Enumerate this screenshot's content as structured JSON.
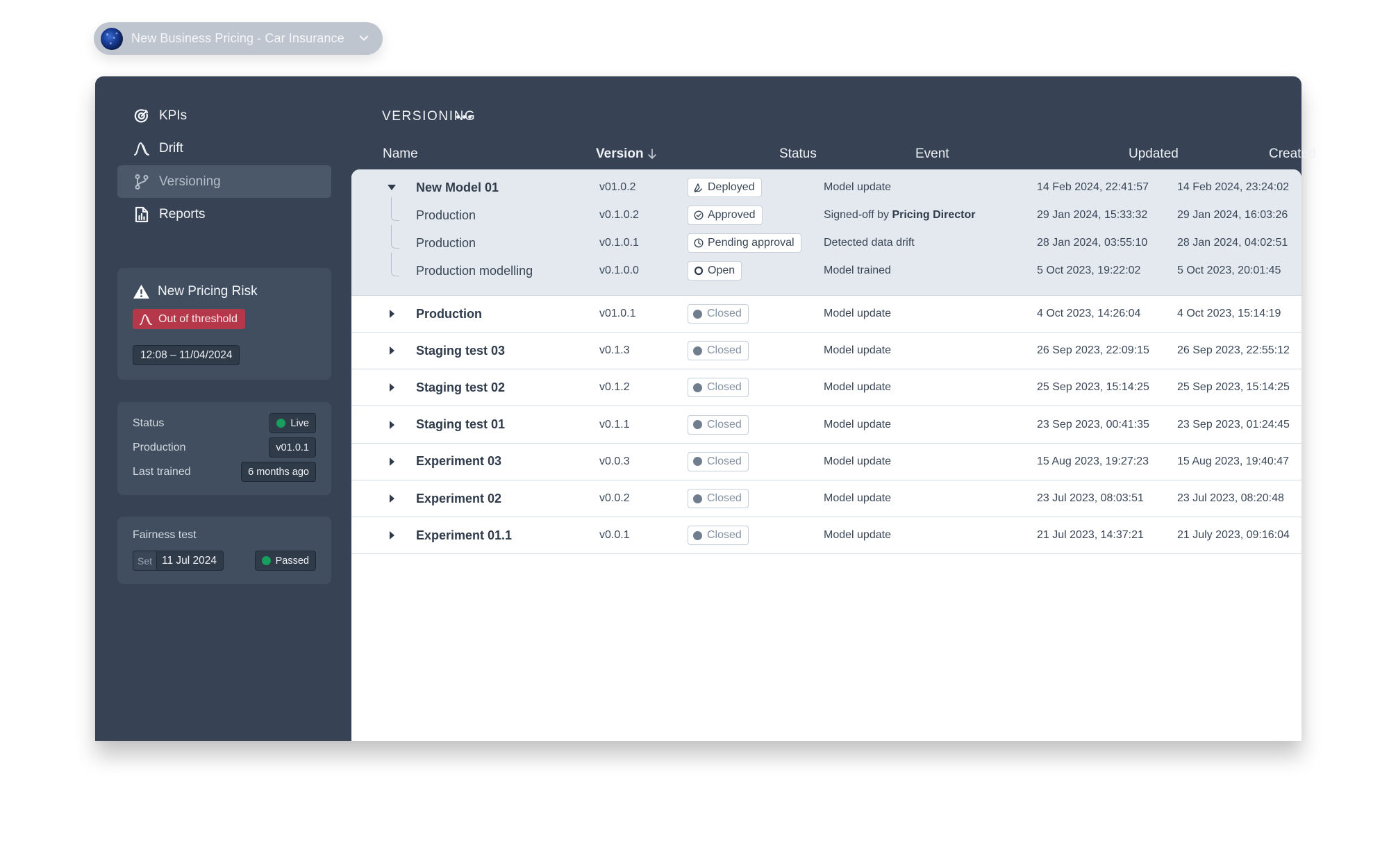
{
  "project_selector": {
    "name": "New Business Pricing - Car Insurance",
    "avatar_icon": "galaxy-avatar",
    "chevron_icon": "chevron-down-icon"
  },
  "sidebar": {
    "nav": [
      {
        "label": "KPIs",
        "icon": "target-icon",
        "active": false
      },
      {
        "label": "Drift",
        "icon": "drift-curve-icon",
        "active": false
      },
      {
        "label": "Versioning",
        "icon": "git-branch-icon",
        "active": true
      },
      {
        "label": "Reports",
        "icon": "report-icon",
        "active": false
      }
    ],
    "risk_card": {
      "title": "New Pricing Risk",
      "title_icon": "warning-icon",
      "badge": "Out of threshold",
      "badge_icon": "drift-curve-icon",
      "badge_color": "#b5374a",
      "time_range": "12:08 – 11/04/2024"
    },
    "status_card": {
      "rows": [
        {
          "label": "Status",
          "value": "Live",
          "indicator_color": "#17a05d"
        },
        {
          "label": "Production",
          "value": "v01.0.1"
        },
        {
          "label": "Last trained",
          "value": "6 months ago"
        }
      ]
    },
    "fairness_card": {
      "title": "Fairness test",
      "set_label": "Set",
      "set_date": "11 Jul 2024",
      "result": "Passed",
      "result_color": "#17a05d"
    }
  },
  "main": {
    "section_title": "VERSIONING",
    "more_icon": "more-horizontal-icon",
    "columns": {
      "name": "Name",
      "version": "Version",
      "status": "Status",
      "event": "Event",
      "updated": "Updated",
      "created": "Created"
    },
    "sort": {
      "column": "version",
      "direction": "descending",
      "icon": "arrow-down-icon"
    },
    "expanded_group": {
      "parent": {
        "name": "New Model 01",
        "version": "v01.0.2",
        "status": "Deployed",
        "status_icon": "deploy-icon",
        "event": "Model update",
        "updated": "14 Feb 2024, 22:41:57",
        "created": "14 Feb 2024, 23:24:02"
      },
      "children": [
        {
          "name": "Production",
          "version": "v0.1.0.2",
          "status": "Approved",
          "status_icon": "check-circle-icon",
          "event_prefix": "Signed-off by ",
          "event_emphasis": "Pricing Director",
          "updated": "29 Jan 2024, 15:33:32",
          "created": "29 Jan 2024, 16:03:26"
        },
        {
          "name": "Production",
          "version": "v0.1.0.1",
          "status": "Pending approval",
          "status_icon": "clock-icon",
          "event_prefix": "Detected data drift",
          "event_emphasis": "",
          "updated": "28 Jan 2024, 03:55:10",
          "created": "28 Jan 2024, 04:02:51"
        },
        {
          "name": "Production modelling",
          "version": "v0.1.0.0",
          "status": "Open",
          "status_icon": "open-circle-icon",
          "event_prefix": "Model trained",
          "event_emphasis": "",
          "updated": "5 Oct 2023, 19:22:02",
          "created": "5 Oct 2023, 20:01:45"
        }
      ]
    },
    "rows": [
      {
        "name": "Production",
        "version": "v01.0.1",
        "status": "Closed",
        "event": "Model update",
        "updated": "4 Oct 2023, 14:26:04",
        "created": "4 Oct 2023, 15:14:19"
      },
      {
        "name": "Staging test 03",
        "version": "v0.1.3",
        "status": "Closed",
        "event": "Model update",
        "updated": "26 Sep 2023, 22:09:15",
        "created": "26 Sep 2023, 22:55:12"
      },
      {
        "name": "Staging test 02",
        "version": "v0.1.2",
        "status": "Closed",
        "event": "Model update",
        "updated": "25 Sep 2023, 15:14:25",
        "created": "25 Sep 2023, 15:14:25"
      },
      {
        "name": "Staging test 01",
        "version": "v0.1.1",
        "status": "Closed",
        "event": "Model update",
        "updated": "23 Sep 2023, 00:41:35",
        "created": "23 Sep 2023, 01:24:45"
      },
      {
        "name": "Experiment 03",
        "version": "v0.0.3",
        "status": "Closed",
        "event": "Model update",
        "updated": "15 Aug 2023, 19:27:23",
        "created": "15 Aug 2023, 19:40:47"
      },
      {
        "name": "Experiment 02",
        "version": "v0.0.2",
        "status": "Closed",
        "event": "Model update",
        "updated": "23 Jul 2023, 08:03:51",
        "created": "23 Jul 2023, 08:20:48"
      },
      {
        "name": "Experiment 01.1",
        "version": "v0.0.1",
        "status": "Closed",
        "event": "Model update",
        "updated": "21 Jul 2023, 14:37:21",
        "created": "21 July 2023, 09:16:04"
      }
    ]
  }
}
